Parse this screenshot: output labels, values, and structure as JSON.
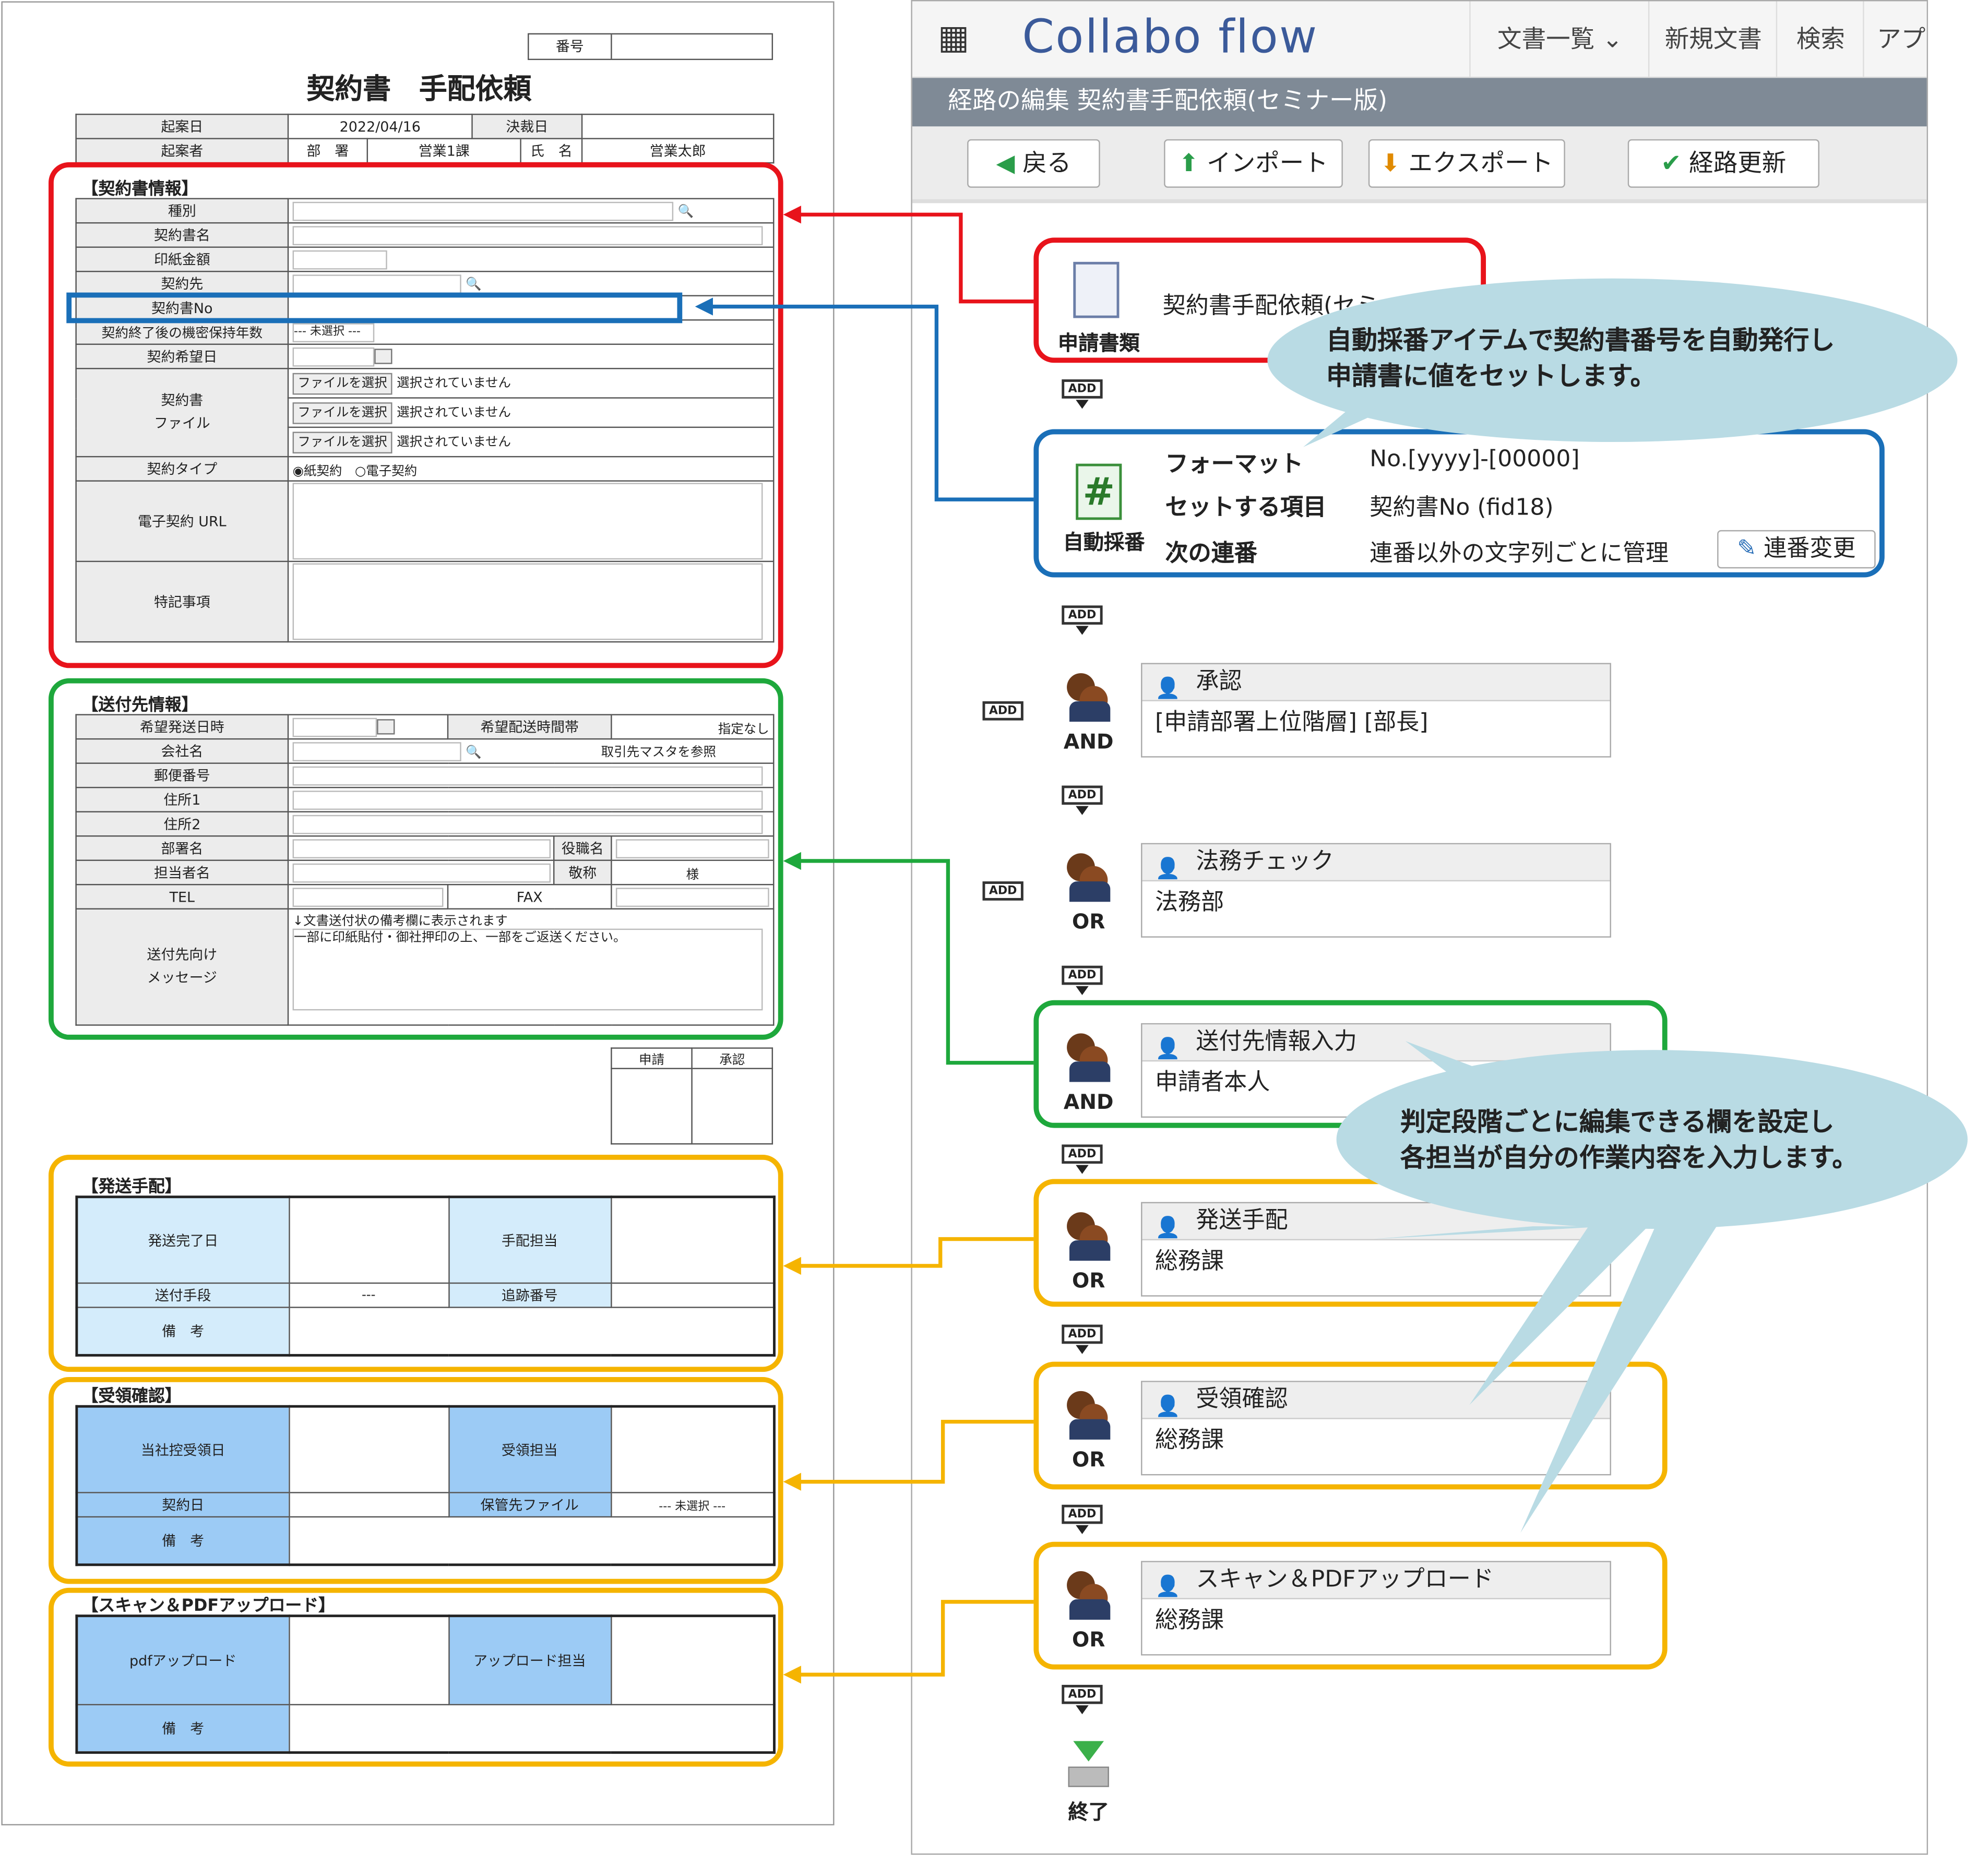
{
  "form": {
    "number_label": "番号",
    "title": "契約書　手配依頼",
    "header": {
      "draft_date_label": "起案日",
      "draft_date": "2022/04/16",
      "decision_date_label": "決裁日",
      "drafter_label": "起案者",
      "dept_label": "部　署",
      "dept": "営業1課",
      "name_label": "氏　名",
      "name": "営業太郎"
    },
    "contract": {
      "title": "【契約書情報】",
      "type": "種別",
      "contract_name": "契約書名",
      "stamp_amount": "印紙金額",
      "counterparty": "契約先",
      "contract_no": "契約書No",
      "retention": "契約終了後の機密保持年数",
      "retention_value": "--- 未選択 ---",
      "desired_date": "契約希望日",
      "file_label": "契約書\nファイル",
      "file_btn": "ファイルを選択",
      "file_none": "選択されていません",
      "contract_type": "契約タイプ",
      "type_paper": "紙契約",
      "type_electronic": "電子契約",
      "url": "電子契約 URL",
      "notes": "特記事項"
    },
    "delivery": {
      "title": "【送付先情報】",
      "send_datetime": "希望発送日時",
      "time_slot": "希望配送時間帯",
      "time_slot_value": "指定なし",
      "company": "会社名",
      "partner_master": "取引先マスタを参照",
      "zip": "郵便番号",
      "addr1": "住所1",
      "addr2": "住所2",
      "dept": "部署名",
      "position": "役職名",
      "person": "担当者名",
      "honorific": "敬称",
      "honorific_value": "様",
      "tel": "TEL",
      "fax": "FAX",
      "message_label": "送付先向け\nメッセージ",
      "message_note": "↓文書送付状の備考欄に表示されます",
      "message_value": "一部に印紙貼付・御社押印の上、一部をご返送ください。"
    },
    "stamp": {
      "apply": "申請",
      "approve": "承認"
    },
    "shipping": {
      "title": "【発送手配】",
      "done_date": "発送完了日",
      "handler": "手配担当",
      "method": "送付手段",
      "method_value": "---",
      "tracking": "追跡番号",
      "remarks": "備　考"
    },
    "receipt": {
      "title": "【受領確認】",
      "receive_date": "当社控受領日",
      "handler": "受領担当",
      "contract_date": "契約日",
      "storage": "保管先ファイル",
      "storage_value": "--- 未選択 ---",
      "remarks": "備　考"
    },
    "scan": {
      "title": "【スキャン＆PDFアップロード】",
      "pdf": "pdfアップロード",
      "handler": "アップロード担当",
      "remarks": "備　考"
    }
  },
  "app": {
    "logo": "Collabo flow",
    "nav": [
      "文書一覧",
      "新規文書",
      "検索",
      "アプ"
    ],
    "page_title": "経路の編集 契約書手配依頼(セミナー版)",
    "buttons": {
      "back": "戻る",
      "import": "インポート",
      "export": "エクスポート",
      "update": "経路更新"
    },
    "add": "ADD",
    "apply_doc": {
      "label": "申請書類",
      "name": "契約書手配依頼(セミ"
    },
    "auto": {
      "label": "自動採番",
      "format_label": "フォーマット",
      "format_value": "No.[yyyy]-[00000]",
      "target_label": "セットする項目",
      "target_value": "契約書No (fid18)",
      "next_label": "次の連番",
      "next_value": "連番以外の文字列ごとに管理",
      "change_btn": "連番変更"
    },
    "steps": [
      {
        "type": "AND",
        "title": "承認",
        "body": "[申請部署上位階層] [部長]"
      },
      {
        "type": "OR",
        "title": "法務チェック",
        "body": "法務部"
      },
      {
        "type": "AND",
        "title": "送付先情報入力",
        "body": "申請者本人"
      },
      {
        "type": "OR",
        "title": "発送手配",
        "body": "総務課"
      },
      {
        "type": "OR",
        "title": "受領確認",
        "body": "総務課"
      },
      {
        "type": "OR",
        "title": "スキャン＆PDFアップロード",
        "body": "総務課"
      }
    ],
    "end": "終了",
    "callout1": "自動採番アイテムで契約書番号を自動発行し\n申請書に値をセットします。",
    "callout2": "判定段階ごとに編集できる欄を設定し\n各担当が自分の作業内容を入力します。"
  },
  "colors": {
    "red": "#e8131b",
    "blue": "#1a6fb8",
    "green": "#1ea83c",
    "orange": "#f5b400",
    "bubble": "#b9dbe4"
  }
}
